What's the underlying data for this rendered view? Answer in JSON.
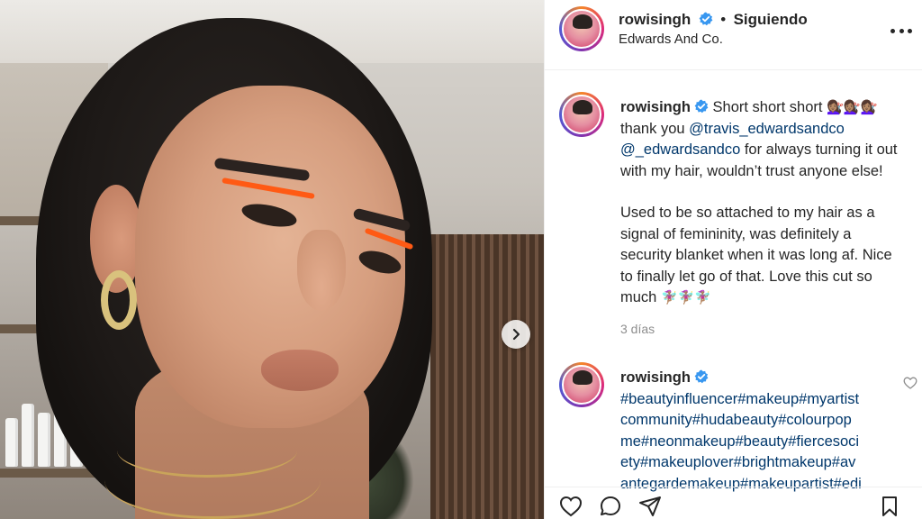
{
  "post": {
    "username": "rowisingh",
    "separator": "•",
    "follow_status": "Siguiendo",
    "location": "Edwards And Co."
  },
  "caption": {
    "username": "rowisingh",
    "text_start": "Short short short",
    "emoji_1": "💇🏽‍♀️💇🏽‍♀️💇🏽‍♀️",
    "thanks": "thank you",
    "mention_1": "@travis_edwardsandco",
    "mention_2": "@_edwardsandco",
    "text_mid": "for always turning it out with my hair, wouldn’t trust anyone else!",
    "paragraph_2": "Used to be so attached to my hair as a signal of femininity, was definitely a security blanket when it was long af. Nice to finally let go of that. Love this cut so much",
    "emoji_2": "🧚🏽‍♀️🧚🏽‍♀️🧚🏽‍♀️",
    "time": "3 días"
  },
  "comment": {
    "username": "rowisingh",
    "hashtags_line1": "#beautyinfluencer#makeup#myartist",
    "hashtags_line2": "community#hudabeauty#colourpop",
    "hashtags_line3": "me#neonmakeup#beauty#fiercesoci",
    "hashtags_line4": "ety#makeuplover#brightmakeup#av",
    "hashtags_line5": "antegardemakeup#makeupartist#edi"
  },
  "colors": {
    "link": "#00376b",
    "verified": "#3897f0",
    "muted": "#8e8e8e",
    "text": "#262626"
  }
}
